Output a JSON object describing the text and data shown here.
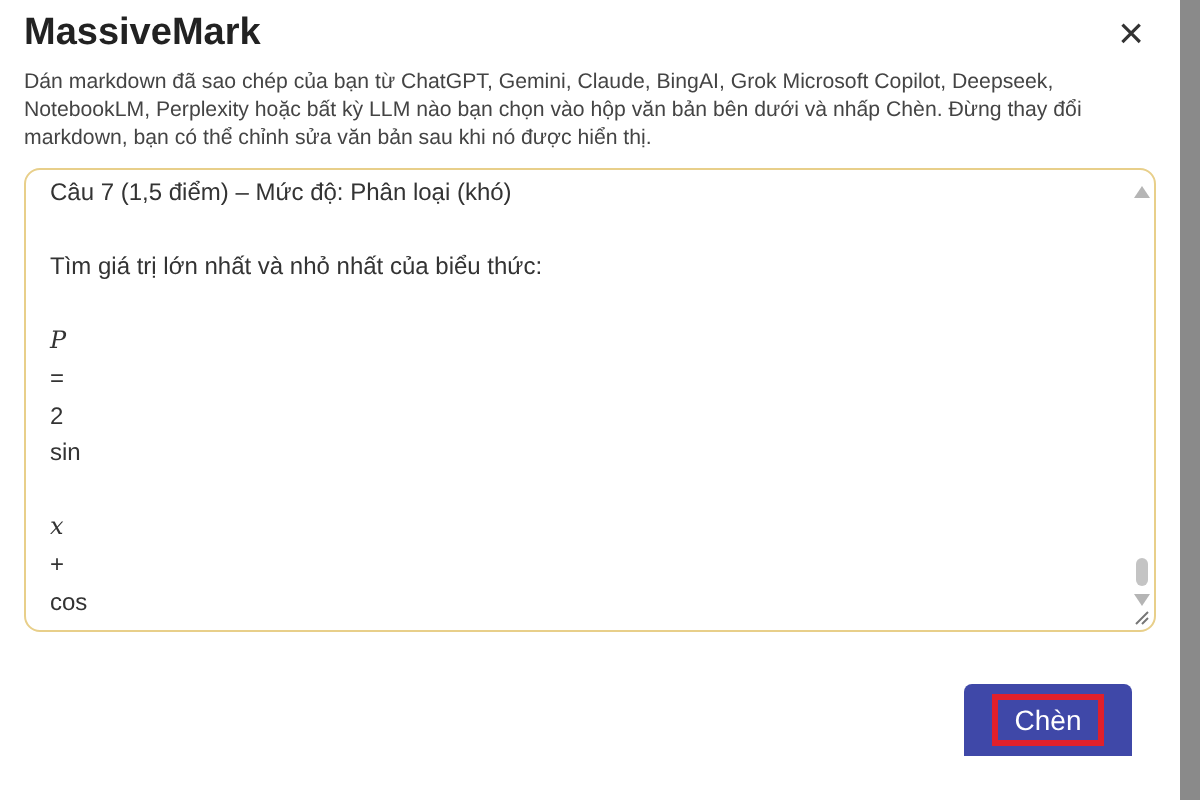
{
  "dialog": {
    "title": "MassiveMark",
    "close_icon": "×",
    "description": "Dán markdown đã sao chép của bạn từ ChatGPT, Gemini, Claude, BingAI, Grok Microsoft Copilot, Deepseek, NotebookLM, Perplexity hoặc bất kỳ LLM nào bạn chọn vào hộp văn bản bên dưới và nhấp Chèn. Đừng thay đổi markdown, bạn có thể chỉnh sửa văn bản sau khi nó được hiển thị.",
    "editor": {
      "lines": [
        {
          "kind": "text",
          "text": "Câu 7 (1,5 điểm) – Mức độ: Phân loại (khó)"
        },
        {
          "kind": "blank"
        },
        {
          "kind": "text",
          "text": "Tìm giá trị lớn nhất và nhỏ nhất của biểu thức:"
        },
        {
          "kind": "blank"
        },
        {
          "kind": "var",
          "text": "P"
        },
        {
          "kind": "text",
          "text": "="
        },
        {
          "kind": "text",
          "text": "2"
        },
        {
          "kind": "text",
          "text": "sin"
        },
        {
          "kind": "blank"
        },
        {
          "kind": "var",
          "text": "x"
        },
        {
          "kind": "text",
          "text": "+"
        },
        {
          "kind": "text",
          "text": "cos"
        }
      ]
    },
    "insert_button": {
      "label": "Chèn",
      "highlighted": true
    }
  }
}
